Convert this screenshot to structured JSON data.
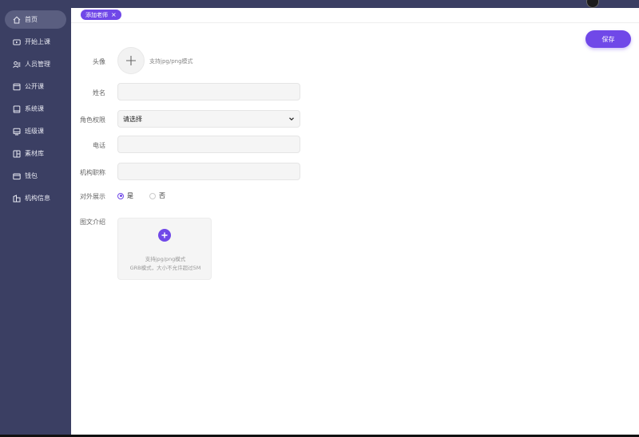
{
  "sidebar": {
    "items": [
      {
        "label": "首页",
        "icon": "home-icon",
        "active": true
      },
      {
        "label": "开始上课",
        "icon": "video-icon"
      },
      {
        "label": "人员管理",
        "icon": "users-icon"
      },
      {
        "label": "公开课",
        "icon": "window-icon"
      },
      {
        "label": "系统课",
        "icon": "book-icon"
      },
      {
        "label": "班级课",
        "icon": "board-icon"
      },
      {
        "label": "素材库",
        "icon": "layout-icon"
      },
      {
        "label": "钱包",
        "icon": "wallet-icon"
      },
      {
        "label": "机构信息",
        "icon": "building-icon"
      }
    ]
  },
  "tab": {
    "label": "添加老师",
    "close": "×"
  },
  "toolbar": {
    "save_label": "保存"
  },
  "form": {
    "avatar_label": "头像",
    "avatar_hint": "支持jpg/png模式",
    "name_label": "姓名",
    "name_value": "",
    "role_label": "角色权限",
    "role_value": "请选择",
    "phone_label": "电话",
    "phone_value": "",
    "title_label": "机构职称",
    "title_value": "",
    "display_label": "对外展示",
    "display_yes": "是",
    "display_no": "否",
    "intro_label": "图文介绍",
    "intro_hint_line1": "支持jpg/png模式",
    "intro_hint_line2": "GRB模式，大小不允许超过5M"
  },
  "colors": {
    "accent": "#7048e8",
    "sidebar": "#3b3f63"
  }
}
